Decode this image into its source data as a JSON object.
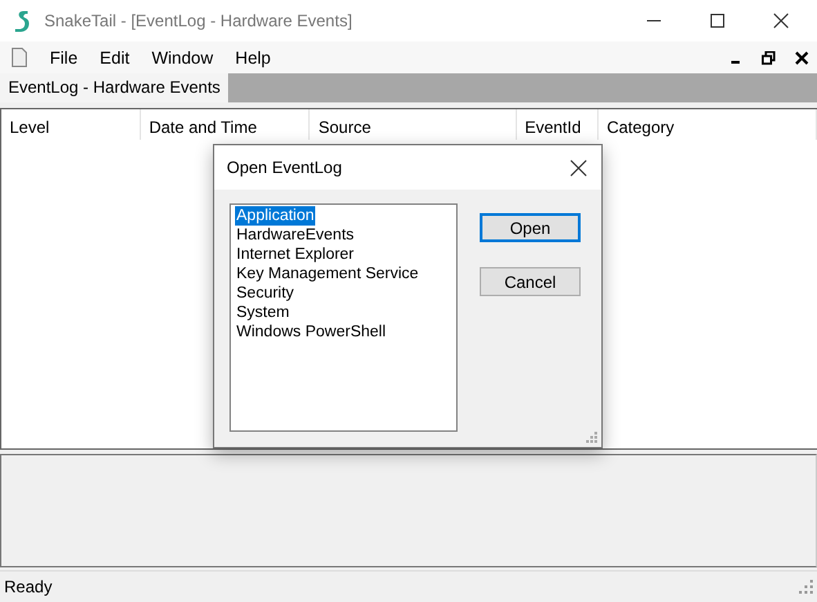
{
  "window": {
    "title": "SnakeTail - [EventLog - Hardware Events]"
  },
  "menu": [
    "File",
    "Edit",
    "Window",
    "Help"
  ],
  "tabs": [
    {
      "label": "EventLog - Hardware Events",
      "selected": true
    }
  ],
  "table": {
    "columns": [
      "Level",
      "Date and Time",
      "Source",
      "EventId",
      "Category"
    ]
  },
  "dialog": {
    "title": "Open EventLog",
    "items": [
      {
        "label": "Application",
        "selected": true
      },
      {
        "label": "HardwareEvents",
        "selected": false
      },
      {
        "label": "Internet Explorer",
        "selected": false
      },
      {
        "label": "Key Management Service",
        "selected": false
      },
      {
        "label": "Security",
        "selected": false
      },
      {
        "label": "System",
        "selected": false
      },
      {
        "label": "Windows PowerShell",
        "selected": false
      }
    ],
    "buttons": [
      {
        "label": "Open",
        "kind": "default"
      },
      {
        "label": "Cancel",
        "kind": "normal"
      }
    ]
  },
  "status_bar": {
    "text": "Ready"
  }
}
